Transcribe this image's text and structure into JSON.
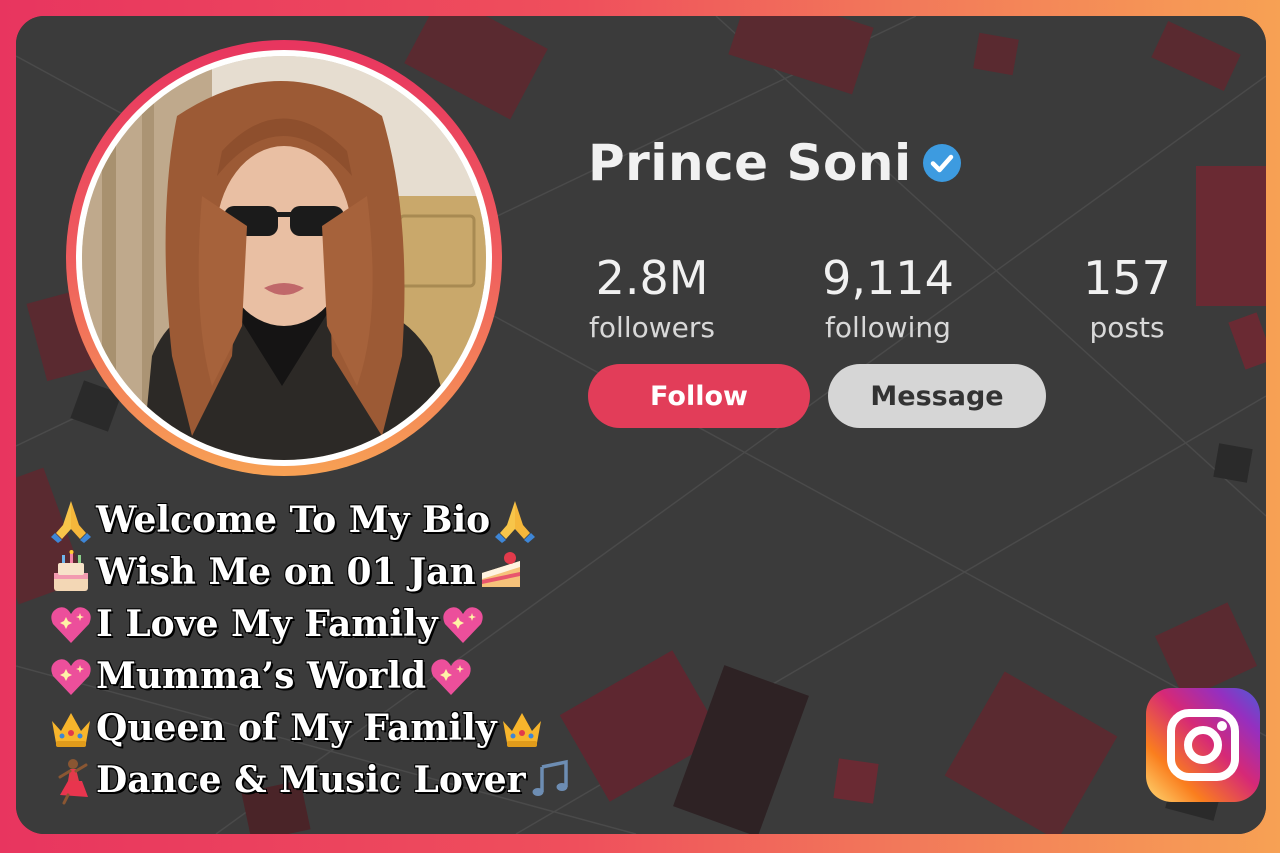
{
  "profile": {
    "name": "Prince Soni",
    "verified": true
  },
  "stats": [
    {
      "value": "2.8M",
      "label": "followers"
    },
    {
      "value": "9,114",
      "label": "following"
    },
    {
      "value": "157",
      "label": "posts"
    }
  ],
  "actions": {
    "follow_label": "Follow",
    "message_label": "Message"
  },
  "bio": [
    {
      "text": "Welcome To My Bio",
      "lead_icon": "praying-hands-icon",
      "trail_icon": "praying-hands-icon"
    },
    {
      "text": "Wish Me on 01 Jan",
      "lead_icon": "birthday-cake-icon",
      "trail_icon": "cake-slice-icon"
    },
    {
      "text": "I Love My Family",
      "lead_icon": "sparkling-heart-icon",
      "trail_icon": "sparkling-heart-icon"
    },
    {
      "text": "Mumma’s World",
      "lead_icon": "sparkling-heart-icon",
      "trail_icon": "sparkling-heart-icon"
    },
    {
      "text": "Queen of My Family",
      "lead_icon": "crown-icon",
      "trail_icon": "crown-icon"
    },
    {
      "text": "Dance & Music Lover",
      "lead_icon": "dancer-icon",
      "trail_icon": "music-notes-icon"
    }
  ],
  "colors": {
    "accent": "#e23d59",
    "verified_badge": "#3d9be0",
    "card_background": "#3a3a3a",
    "message_button": "#d6d6d6"
  },
  "brand_icon": "instagram-icon"
}
